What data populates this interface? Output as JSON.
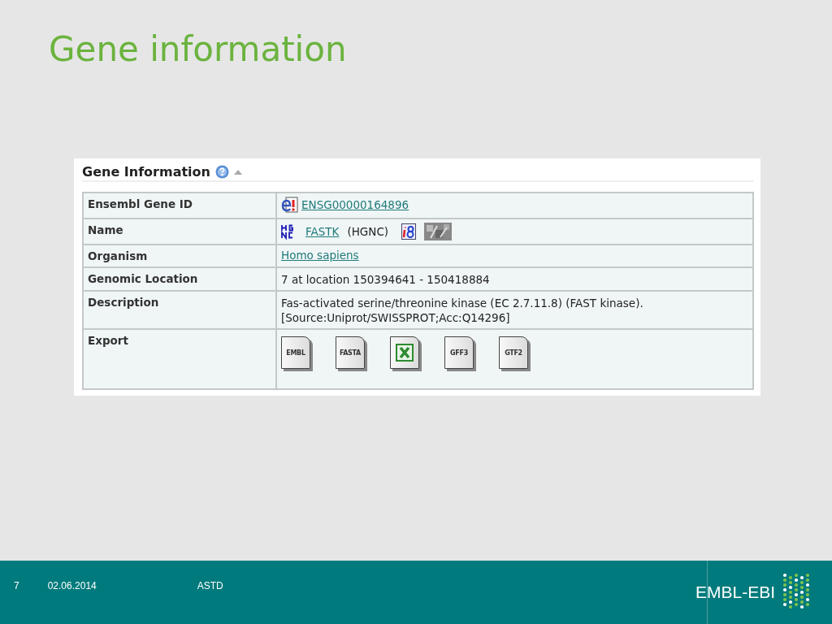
{
  "slide": {
    "title": "Gene information"
  },
  "panel": {
    "title": "Gene Information",
    "rows": [
      {
        "kind": "ensembl",
        "label": "Ensembl Gene ID",
        "link": "ENSG00000164896"
      },
      {
        "kind": "name",
        "label": "Name",
        "link": "FASTK",
        "suffix": "(HGNC)"
      },
      {
        "kind": "link",
        "label": "Organism",
        "link": "Homo sapiens"
      },
      {
        "kind": "text",
        "label": "Genomic Location",
        "lines": [
          "7 at location 150394641 - 150418884"
        ]
      },
      {
        "kind": "text",
        "label": "Description",
        "lines": [
          "Fas-activated serine/threonine kinase (EC 2.7.11.8) (FAST kinase).",
          "[Source:Uniprot/SWISSPROT;Acc:Q14296]"
        ]
      },
      {
        "kind": "export",
        "label": "Export",
        "files": [
          {
            "kind": "doc",
            "label": "EMBL"
          },
          {
            "kind": "doc",
            "label": "FASTA"
          },
          {
            "kind": "excel"
          },
          {
            "kind": "doc",
            "label": "GFF3"
          },
          {
            "kind": "doc",
            "label": "GTF2"
          }
        ]
      }
    ]
  },
  "footer": {
    "page": "7",
    "date": "02.06.2014",
    "event": "ASTD",
    "logo": "EMBL-EBI"
  }
}
